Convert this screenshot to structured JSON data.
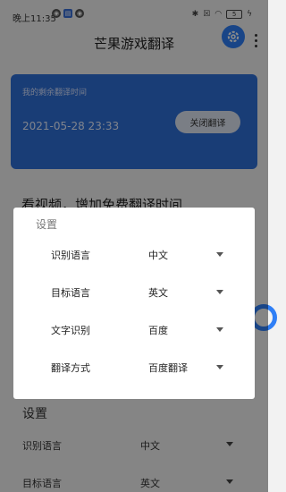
{
  "status_bar": {
    "time": "晚上11:35",
    "battery": "5"
  },
  "app": {
    "title": "芒果游戏翻译"
  },
  "time_card": {
    "label": "我的剩余翻译时间",
    "value": "2021-05-28 23:33",
    "close_label": "关闭翻译",
    "color": "#2f6fd8"
  },
  "video_section": {
    "title": "看视频，增加免费翻译时间"
  },
  "background_settings": {
    "title": "设置",
    "rows": [
      {
        "label": "识别语言",
        "value": "中文"
      },
      {
        "label": "目标语言",
        "value": "英文"
      }
    ]
  },
  "dialog": {
    "title": "设置",
    "rows": [
      {
        "label": "识别语言",
        "value": "中文"
      },
      {
        "label": "目标语言",
        "value": "英文"
      },
      {
        "label": "文字识别",
        "value": "百度"
      },
      {
        "label": "翻译方式",
        "value": "百度翻译"
      }
    ]
  },
  "accent_color": "#2f7ff6"
}
